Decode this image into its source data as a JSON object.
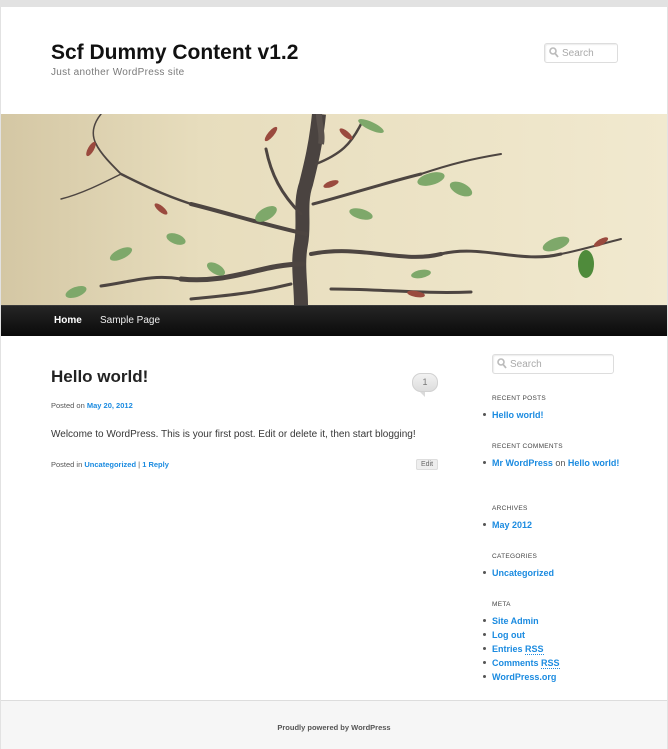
{
  "site": {
    "title": "Scf Dummy Content v1.2",
    "description": "Just another WordPress site"
  },
  "search": {
    "placeholder": "Search",
    "icon": "magnifier-icon"
  },
  "nav": {
    "items": [
      "Home",
      "Sample Page"
    ],
    "current": "Home"
  },
  "post": {
    "title": "Hello world!",
    "comment_count": "1",
    "posted_on_label": "Posted on",
    "date": "May 20, 2012",
    "content": "Welcome to WordPress. This is your first post. Edit or delete it, then start blogging!",
    "posted_in_label": "Posted in",
    "category": "Uncategorized",
    "separator": "|",
    "reply_link": "1 Reply",
    "edit_label": "Edit"
  },
  "sidebar": {
    "search_placeholder": "Search",
    "recent_posts": {
      "title": "RECENT POSTS",
      "items": [
        "Hello world!"
      ]
    },
    "recent_comments": {
      "title": "RECENT COMMENTS",
      "items": [
        {
          "author": "Mr WordPress",
          "on": "on",
          "post": "Hello world!"
        }
      ]
    },
    "archives": {
      "title": "ARCHIVES",
      "items": [
        "May 2012"
      ]
    },
    "categories": {
      "title": "CATEGORIES",
      "items": [
        "Uncategorized"
      ]
    },
    "meta": {
      "title": "META",
      "items": [
        "Site Admin",
        "Log out",
        "Entries",
        "Comments",
        "WordPress.org"
      ],
      "rss_label": "RSS"
    }
  },
  "footer": {
    "text": "Proudly powered by WordPress"
  },
  "colors": {
    "link": "#1b8be0",
    "nav_bg": "#111111",
    "page_bg": "#e2e2e2"
  }
}
